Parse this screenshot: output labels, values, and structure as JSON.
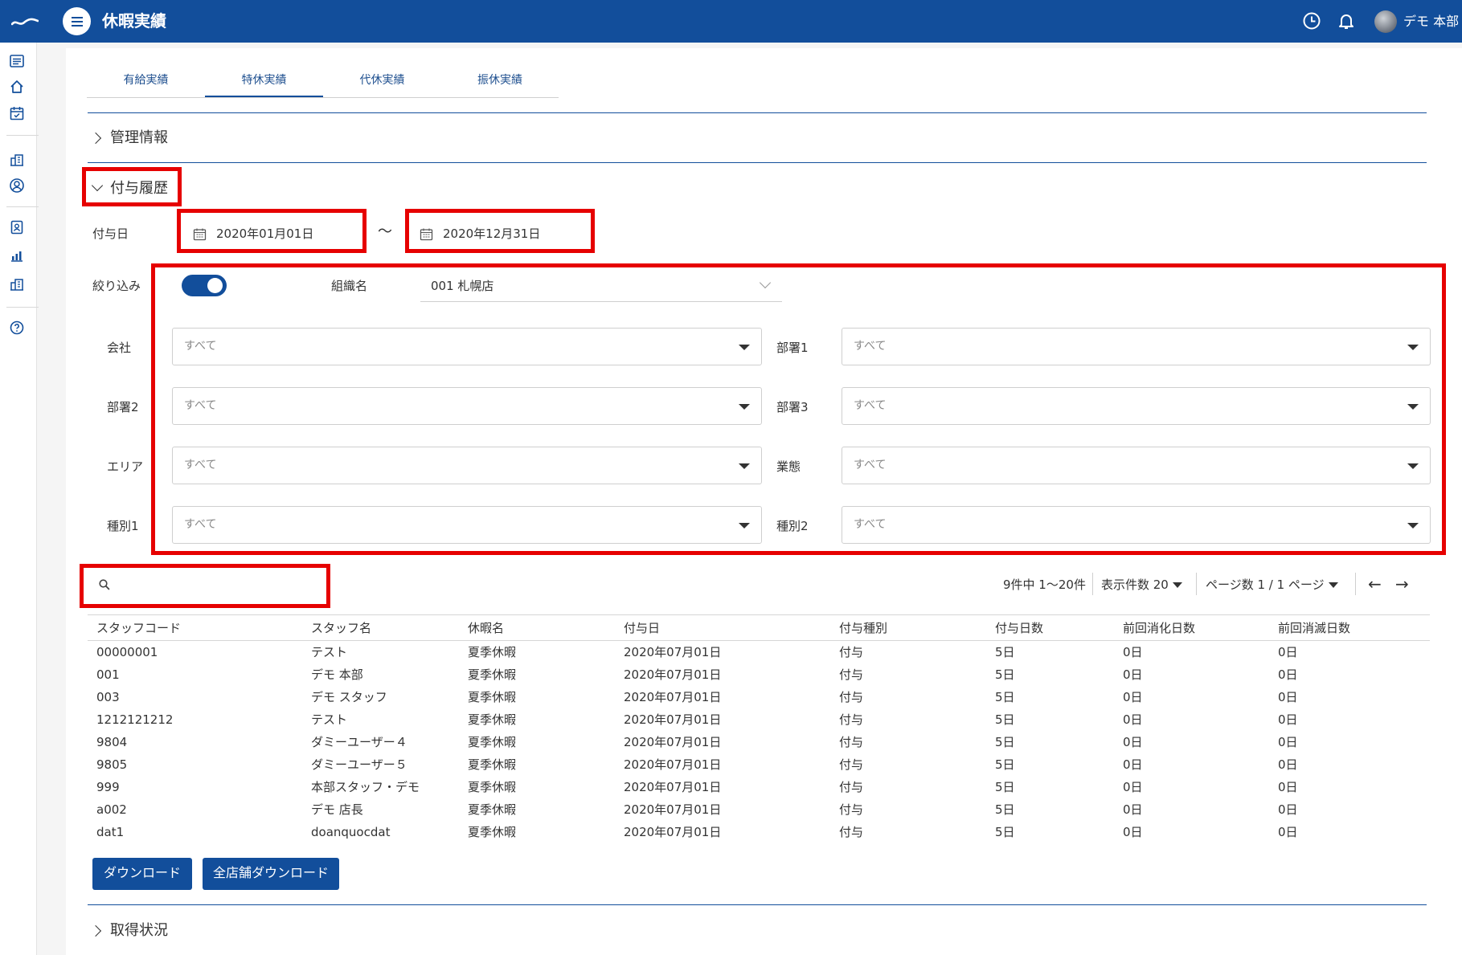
{
  "header": {
    "title": "休暇実績",
    "user_name": "デモ 本部"
  },
  "tabs": [
    {
      "label": "有給実績"
    },
    {
      "label": "特休実績"
    },
    {
      "label": "代休実績"
    },
    {
      "label": "振休実績"
    }
  ],
  "sections": {
    "management": "管理情報",
    "grant_history": "付与履歴",
    "acquisition": "取得状況"
  },
  "filters": {
    "grant_date_label": "付与日",
    "date_from": "2020年01月01日",
    "date_separator": "〜",
    "date_to": "2020年12月31日",
    "narrow_label": "絞り込み",
    "narrow_enabled": true,
    "org_label": "組織名",
    "org_value": "001 札幌店",
    "company_label": "会社",
    "company_value": "すべて",
    "dept1_label": "部署1",
    "dept1_value": "すべて",
    "dept2_label": "部署2",
    "dept2_value": "すべて",
    "dept3_label": "部署3",
    "dept3_value": "すべて",
    "area_label": "エリア",
    "area_value": "すべて",
    "business_label": "業態",
    "business_value": "すべて",
    "type1_label": "種別1",
    "type1_value": "すべて",
    "type2_label": "種別2",
    "type2_value": "すべて"
  },
  "search": {
    "value": ""
  },
  "pagination": {
    "summary": "9件中 1〜20件",
    "per_page": "表示件数 20",
    "pages": "ページ数 1 / 1 ページ",
    "prev": "←",
    "next": "→"
  },
  "table": {
    "columns": [
      "スタッフコード",
      "スタッフ名",
      "休暇名",
      "付与日",
      "付与種別",
      "付与日数",
      "前回消化日数",
      "前回消滅日数"
    ],
    "rows": [
      [
        "00000001",
        "テスト",
        "夏季休暇",
        "2020年07月01日",
        "付与",
        "5日",
        "0日",
        "0日"
      ],
      [
        "001",
        "デモ 本部",
        "夏季休暇",
        "2020年07月01日",
        "付与",
        "5日",
        "0日",
        "0日"
      ],
      [
        "003",
        "デモ スタッフ",
        "夏季休暇",
        "2020年07月01日",
        "付与",
        "5日",
        "0日",
        "0日"
      ],
      [
        "1212121212",
        "テスト",
        "夏季休暇",
        "2020年07月01日",
        "付与",
        "5日",
        "0日",
        "0日"
      ],
      [
        "9804",
        "ダミーユーザー４",
        "夏季休暇",
        "2020年07月01日",
        "付与",
        "5日",
        "0日",
        "0日"
      ],
      [
        "9805",
        "ダミーユーザー５",
        "夏季休暇",
        "2020年07月01日",
        "付与",
        "5日",
        "0日",
        "0日"
      ],
      [
        "999",
        "本部スタッフ・デモ",
        "夏季休暇",
        "2020年07月01日",
        "付与",
        "5日",
        "0日",
        "0日"
      ],
      [
        "a002",
        "デモ 店長",
        "夏季休暇",
        "2020年07月01日",
        "付与",
        "5日",
        "0日",
        "0日"
      ],
      [
        "dat1",
        "doanquocdat",
        "夏季休暇",
        "2020年07月01日",
        "付与",
        "5日",
        "0日",
        "0日"
      ]
    ]
  },
  "buttons": {
    "download": "ダウンロード",
    "download_all": "全店舗ダウンロード"
  },
  "colors": {
    "primary": "#124e9b",
    "highlight": "#e60000"
  }
}
